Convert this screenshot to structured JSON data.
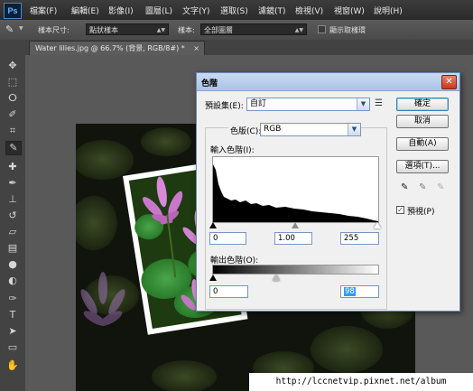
{
  "app": {
    "logo": "Ps"
  },
  "menu": [
    "檔案(F)",
    "編輯(E)",
    "影像(I)",
    "圖層(L)",
    "文字(Y)",
    "選取(S)",
    "濾鏡(T)",
    "檢視(V)",
    "視窗(W)",
    "說明(H)"
  ],
  "options": {
    "sample_size_label": "樣本尺寸:",
    "sample_size_value": "點狀樣本",
    "sample_label": "樣本:",
    "sample_value": "全部圖層",
    "show_ring_label": "顯示取樣環"
  },
  "document": {
    "tab_title": "Water lilies.jpg @ 66.7% (背景, RGB/8#) *",
    "tab_close": "×"
  },
  "dialog": {
    "title": "色階",
    "close": "✕",
    "preset_label": "預設集(E):",
    "preset_value": "自訂",
    "channel_label": "色版(C):",
    "channel_value": "RGB",
    "input_levels_label": "輸入色階(I):",
    "input_black": "0",
    "input_gamma": "1.00",
    "input_white": "255",
    "output_levels_label": "輸出色階(O):",
    "output_black": "0",
    "output_white": "98",
    "buttons": {
      "ok": "確定",
      "cancel": "取消",
      "auto": "自動(A)",
      "options": "選項(T)..."
    },
    "preview_label": "預視(P)",
    "preview_checked": true
  },
  "watermark": "http://lccnetvip.pixnet.net/album",
  "colors": {
    "menubar": "#2f2f2f",
    "dialog_title": "#b4cbea",
    "close_button": "#d14a2c",
    "selection": "#3399ff"
  },
  "icons": [
    "eyedropper-icon",
    "move-icon",
    "marquee-icon",
    "lasso-icon",
    "quick-select-icon",
    "crop-icon",
    "healing-icon",
    "brush-icon",
    "stamp-icon",
    "history-brush-icon",
    "eraser-icon",
    "gradient-icon",
    "blur-icon",
    "dodge-icon",
    "pen-icon",
    "type-icon",
    "path-select-icon",
    "shape-icon",
    "hand-icon",
    "black-point-eyedropper-icon",
    "gray-point-eyedropper-icon",
    "white-point-eyedropper-icon",
    "preset-menu-icon"
  ]
}
